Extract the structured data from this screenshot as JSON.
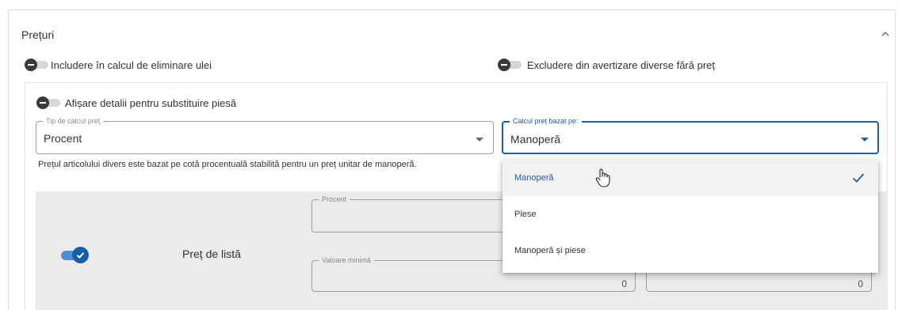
{
  "section": {
    "title": "Prețuri"
  },
  "toggles": {
    "include_oil": "Includere în calcul de eliminare ulei",
    "exclude_misc": "Excludere din avertizare diverse fără preț",
    "show_details": "Afișare detalii pentru substituire piesă"
  },
  "calc_type": {
    "legend": "Tip de calcul preț",
    "value": "Procent"
  },
  "price_basis": {
    "legend": "Calcul preț bazat pe:",
    "value": "Manoperă",
    "options": [
      "Manoperă",
      "Piese",
      "Manoperă și piese"
    ],
    "selected_index": 0
  },
  "helper_text": "Prețul articolului divers este bazat pe cotă procentuală stabilită pentru un preț unitar de manoperă.",
  "list_price": {
    "label": "Preț de listă",
    "enabled": true,
    "percent_legend": "Procent",
    "min_value_legend": "Valoare minimă",
    "min_value": "0",
    "second_value": "0"
  },
  "colors": {
    "accent": "#1b5ea8",
    "toggle_track_on": "#4b8fd6",
    "panel_bg": "#ebebeb"
  }
}
